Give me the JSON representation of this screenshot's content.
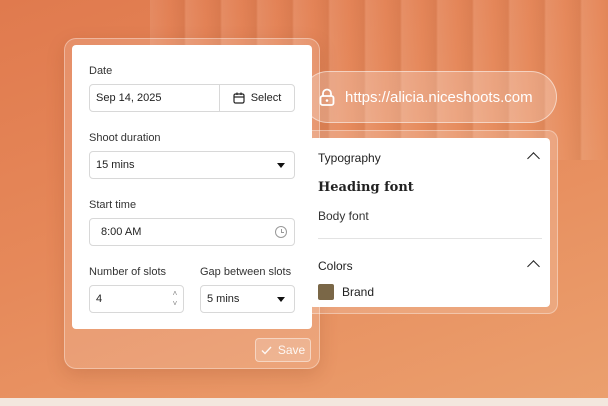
{
  "form": {
    "date_label": "Date",
    "date_value": "Sep 14, 2025",
    "select_label": "Select",
    "duration_label": "Shoot duration",
    "duration_value": "15 mins",
    "start_label": "Start time",
    "start_value": "8:00  AM",
    "slots_label": "Number of slots",
    "slots_value": "4",
    "gap_label": "Gap between slots",
    "gap_value": "5 mins",
    "save_label": "Save"
  },
  "url": "https://alicia.niceshoots.com",
  "typography": {
    "section_title": "Typography",
    "heading_font": "Heading font",
    "body_font": "Body font"
  },
  "colors": {
    "section_title": "Colors",
    "brand_label": "Brand",
    "brand_color": "#7a6747"
  },
  "icons": [
    "calendar-icon",
    "chevron-down-icon",
    "clock-icon",
    "lock-icon",
    "chevron-up-icon",
    "check-icon"
  ]
}
